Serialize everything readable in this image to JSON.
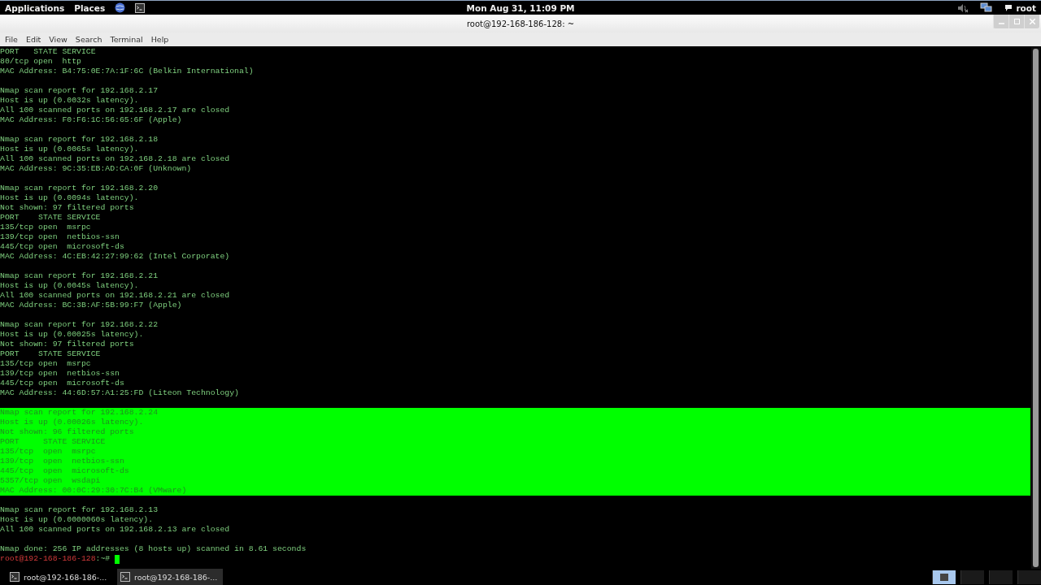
{
  "top_panel": {
    "menus": [
      "Applications",
      "Places"
    ],
    "clock": "Mon Aug 31, 11:09 PM",
    "user": "root"
  },
  "window": {
    "title": "root@192-168-186-128: ~"
  },
  "menu_bar": [
    "File",
    "Edit",
    "View",
    "Search",
    "Terminal",
    "Help"
  ],
  "terminal": {
    "blocks": [
      {
        "selected": false,
        "lines": [
          "PORT   STATE SERVICE",
          "80/tcp open  http",
          "MAC Address: B4:75:0E:7A:1F:6C (Belkin International)"
        ]
      },
      {
        "selected": false,
        "lines": [
          "Nmap scan report for 192.168.2.17",
          "Host is up (0.0032s latency).",
          "All 100 scanned ports on 192.168.2.17 are closed",
          "MAC Address: F0:F6:1C:56:65:6F (Apple)"
        ]
      },
      {
        "selected": false,
        "lines": [
          "Nmap scan report for 192.168.2.18",
          "Host is up (0.0065s latency).",
          "All 100 scanned ports on 192.168.2.18 are closed",
          "MAC Address: 9C:35:EB:AD:CA:0F (Unknown)"
        ]
      },
      {
        "selected": false,
        "lines": [
          "Nmap scan report for 192.168.2.20",
          "Host is up (0.0094s latency).",
          "Not shown: 97 filtered ports",
          "PORT    STATE SERVICE",
          "135/tcp open  msrpc",
          "139/tcp open  netbios-ssn",
          "445/tcp open  microsoft-ds",
          "MAC Address: 4C:EB:42:27:99:62 (Intel Corporate)"
        ]
      },
      {
        "selected": false,
        "lines": [
          "Nmap scan report for 192.168.2.21",
          "Host is up (0.0045s latency).",
          "All 100 scanned ports on 192.168.2.21 are closed",
          "MAC Address: BC:3B:AF:5B:99:F7 (Apple)"
        ]
      },
      {
        "selected": false,
        "lines": [
          "Nmap scan report for 192.168.2.22",
          "Host is up (0.00025s latency).",
          "Not shown: 97 filtered ports",
          "PORT    STATE SERVICE",
          "135/tcp open  msrpc",
          "139/tcp open  netbios-ssn",
          "445/tcp open  microsoft-ds",
          "MAC Address: 44:6D:57:A1:25:FD (Liteon Technology)"
        ]
      },
      {
        "selected": true,
        "lines": [
          "Nmap scan report for 192.168.2.24",
          "Host is up (0.00026s latency).",
          "Not shown: 96 filtered ports",
          "PORT     STATE SERVICE",
          "135/tcp  open  msrpc",
          "139/tcp  open  netbios-ssn",
          "445/tcp  open  microsoft-ds",
          "5357/tcp open  wsdapi",
          "MAC Address: 00:0C:29:30:7C:B4 (VMware)"
        ]
      },
      {
        "selected": false,
        "lines": [
          "Nmap scan report for 192.168.2.13",
          "Host is up (0.0000060s latency).",
          "All 100 scanned ports on 192.168.2.13 are closed"
        ]
      },
      {
        "selected": false,
        "lines": [
          "Nmap done: 256 IP addresses (8 hosts up) scanned in 8.61 seconds"
        ]
      }
    ],
    "prompt": {
      "user_host": "root@192-168-186-128",
      "path": ":~#"
    }
  },
  "taskbar": {
    "tasks": [
      {
        "label": "root@192-168-186-...",
        "selected": false
      },
      {
        "label": "root@192-168-186-...",
        "selected": true
      }
    ],
    "workspaces": [
      {
        "selected": true
      },
      {
        "selected": false
      },
      {
        "selected": false
      },
      {
        "selected": false
      }
    ]
  }
}
